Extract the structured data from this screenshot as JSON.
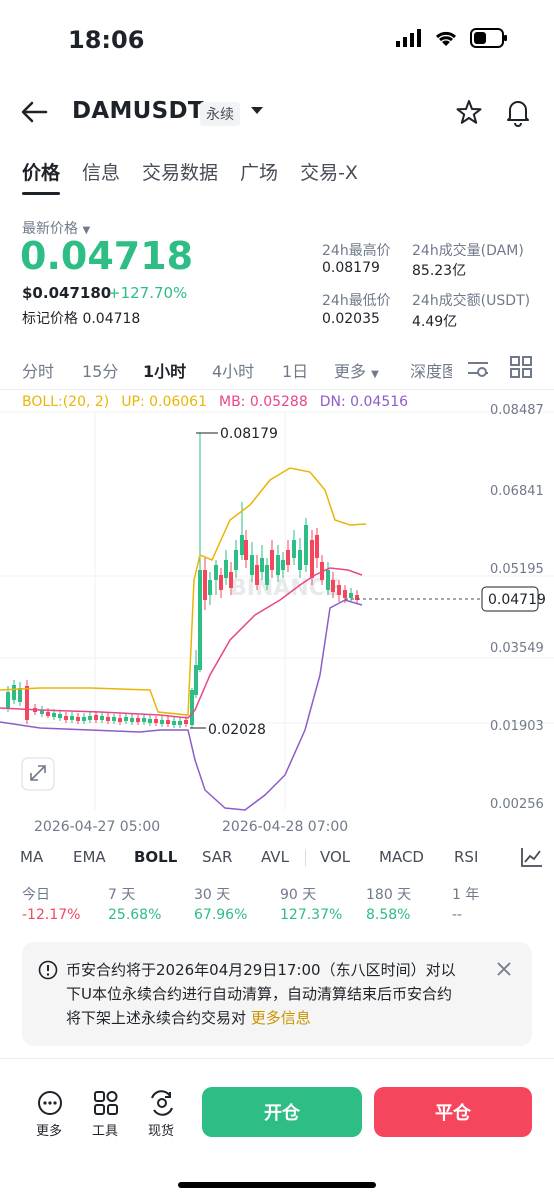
{
  "status": {
    "time": "18:06"
  },
  "header": {
    "symbol": "DAMUSDT",
    "badge": "永续"
  },
  "tabs": [
    "价格",
    "信息",
    "交易数据",
    "广场",
    "交易-X"
  ],
  "price": {
    "latest_label": "最新价格",
    "last": "0.04718",
    "usd": "$0.047180",
    "change": "+127.70%",
    "mark": "标记价格 0.04718"
  },
  "stats": {
    "high_label": "24h最高价",
    "high": "0.08179",
    "vol_label": "24h成交量(DAM)",
    "vol": "85.23亿",
    "low_label": "24h最低价",
    "low": "0.02035",
    "amt_label": "24h成交额(USDT)",
    "amt": "4.49亿"
  },
  "timeframes": [
    "分时",
    "15分",
    "1小时",
    "4小时",
    "1日",
    "更多",
    "深度图"
  ],
  "boll": {
    "label": "BOLL:(20, 2)",
    "up": "UP: 0.06061",
    "mb": "MB: 0.05288",
    "dn": "DN: 0.04516",
    "up_color": "#e8b608",
    "mb_color": "#e8458b",
    "dn_color": "#8e5cc9"
  },
  "chart_data": {
    "type": "candlestick",
    "y_ticks": [
      "0.08487",
      "0.06841",
      "0.05195",
      "0.03549",
      "0.01903",
      "0.00256"
    ],
    "x_ticks": [
      "2026-04-27 05:00",
      "2026-04-28 07:00"
    ],
    "annotations": {
      "high": "0.08179",
      "low": "0.02028",
      "current": "0.04719"
    },
    "watermark": "BINANCE"
  },
  "indicators": [
    "MA",
    "EMA",
    "BOLL",
    "SAR",
    "AVL",
    "VOL",
    "MACD",
    "RSI"
  ],
  "performance": [
    {
      "label": "今日",
      "value": "-12.17%",
      "color": "#f6465d"
    },
    {
      "label": "7 天",
      "value": "25.68%",
      "color": "#2ebd85"
    },
    {
      "label": "30 天",
      "value": "67.96%",
      "color": "#2ebd85"
    },
    {
      "label": "90 天",
      "value": "127.37%",
      "color": "#2ebd85"
    },
    {
      "label": "180 天",
      "value": "8.58%",
      "color": "#2ebd85"
    },
    {
      "label": "1 年",
      "value": "--",
      "color": "#707a8a"
    }
  ],
  "notice": {
    "text": "币安合约将于2026年04月29日17:00（东八区时间）对以下U本位永续合约进行自动清算，自动清算结束后币安合约将下架上述永续合约交易对",
    "link": "更多信息"
  },
  "bottom": {
    "more": "更多",
    "tools": "工具",
    "spot": "现货",
    "open": "开仓",
    "close": "平仓"
  }
}
